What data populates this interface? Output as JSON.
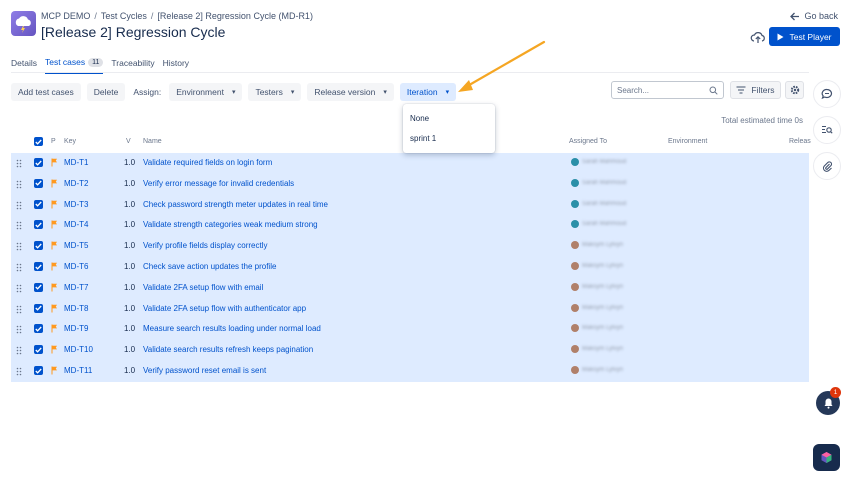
{
  "breadcrumb": {
    "project": "MCP DEMO",
    "section": "Test Cycles",
    "current": "[Release 2] Regression Cycle (MD-R1)",
    "separator": "/"
  },
  "page_title": "[Release 2] Regression Cycle",
  "header": {
    "go_back": "Go back",
    "test_player": "Test Player"
  },
  "tabs": [
    {
      "label": "Details"
    },
    {
      "label": "Test cases",
      "count": "11"
    },
    {
      "label": "Traceability"
    },
    {
      "label": "History"
    }
  ],
  "toolbar": {
    "add_test_cases": "Add test cases",
    "delete": "Delete",
    "assign_label": "Assign:",
    "environment": "Environment",
    "testers": "Testers",
    "release_version": "Release version",
    "iteration": "Iteration",
    "search_placeholder": "Search...",
    "filters": "Filters"
  },
  "iteration_dropdown": {
    "options": [
      "None",
      "sprint 1"
    ]
  },
  "estimated_time": "Total estimated time 0s",
  "columns": {
    "p": "P",
    "key": "Key",
    "v": "V",
    "name": "Name",
    "assigned_to": "Assigned To",
    "environment": "Environment",
    "release": "Releas"
  },
  "rows": [
    {
      "key": "MD-T1",
      "version": "1.0",
      "name": "Validate required fields on login form",
      "assignee": "Sarah Mahmoud",
      "avatar_color": "#2a8fa8"
    },
    {
      "key": "MD-T2",
      "version": "1.0",
      "name": "Verify error message for invalid credentials",
      "assignee": "Sarah Mahmoud",
      "avatar_color": "#2a8fa8"
    },
    {
      "key": "MD-T3",
      "version": "1.0",
      "name": "Check password strength meter updates in real time",
      "assignee": "Sarah Mahmoud",
      "avatar_color": "#2a8fa8"
    },
    {
      "key": "MD-T4",
      "version": "1.0",
      "name": "Validate strength categories weak medium strong",
      "assignee": "Sarah Mahmoud",
      "avatar_color": "#2a8fa8"
    },
    {
      "key": "MD-T5",
      "version": "1.0",
      "name": "Verify profile fields display correctly",
      "assignee": "Maksym Lytvyn",
      "avatar_color": "#b0806a"
    },
    {
      "key": "MD-T6",
      "version": "1.0",
      "name": "Check save action updates the profile",
      "assignee": "Maksym Lytvyn",
      "avatar_color": "#b0806a"
    },
    {
      "key": "MD-T7",
      "version": "1.0",
      "name": "Validate 2FA setup flow with email",
      "assignee": "Maksym Lytvyn",
      "avatar_color": "#b0806a"
    },
    {
      "key": "MD-T8",
      "version": "1.0",
      "name": "Validate 2FA setup flow with authenticator app",
      "assignee": "Maksym Lytvyn",
      "avatar_color": "#b0806a"
    },
    {
      "key": "MD-T9",
      "version": "1.0",
      "name": "Measure search results loading under normal load",
      "assignee": "Maksym Lytvyn",
      "avatar_color": "#b0806a"
    },
    {
      "key": "MD-T10",
      "version": "1.0",
      "name": "Validate search results refresh keeps pagination",
      "assignee": "Maksym Lytvyn",
      "avatar_color": "#b0806a"
    },
    {
      "key": "MD-T11",
      "version": "1.0",
      "name": "Verify password reset email is sent",
      "assignee": "Maksym Lytvyn",
      "avatar_color": "#b0806a"
    }
  ],
  "notifications": {
    "count": "1"
  },
  "colors": {
    "primary": "#0052cc",
    "selection": "#deebff",
    "flag": "#ff991f",
    "annotation_arrow": "#f5a623"
  },
  "icons": [
    "cloud-upload-icon",
    "arrow-left-icon",
    "play-icon",
    "search-icon",
    "filter-icon",
    "gear-icon",
    "chat-icon",
    "search-list-icon",
    "paperclip-icon",
    "bell-icon",
    "flag-icon",
    "drag-handle-icon"
  ]
}
